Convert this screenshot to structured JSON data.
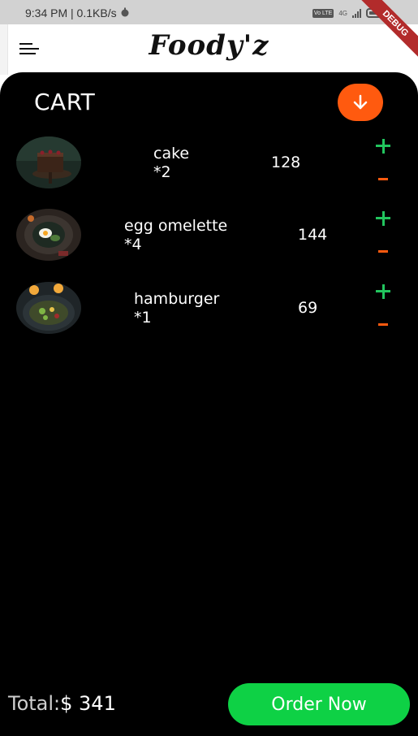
{
  "status_bar": {
    "time_speed": "9:34 PM | 0.1KB/s",
    "volte_badge": "Vo LTE",
    "network": "4G",
    "debug_banner": "DEBUG"
  },
  "app_bar": {
    "brand": "Foody'z",
    "menu_icon": "menu-icon"
  },
  "cart": {
    "title": "CART",
    "collapse_icon": "arrow-down-icon",
    "items": [
      {
        "name": "cake",
        "quantity": "*2",
        "price": "128",
        "image": "cake-photo"
      },
      {
        "name": "egg omelette",
        "quantity": "*4",
        "price": "144",
        "image": "egg-omelette-photo"
      },
      {
        "name": "hamburger",
        "quantity": "*1",
        "price": "69",
        "image": "hamburger-photo"
      }
    ],
    "total_label": "Total:",
    "total_value": "$ 341",
    "order_button": "Order Now"
  },
  "colors": {
    "accent_orange": "#ff5a0f",
    "accent_green": "#0ed145",
    "plus_green": "#22c55e",
    "background": "#000000"
  }
}
